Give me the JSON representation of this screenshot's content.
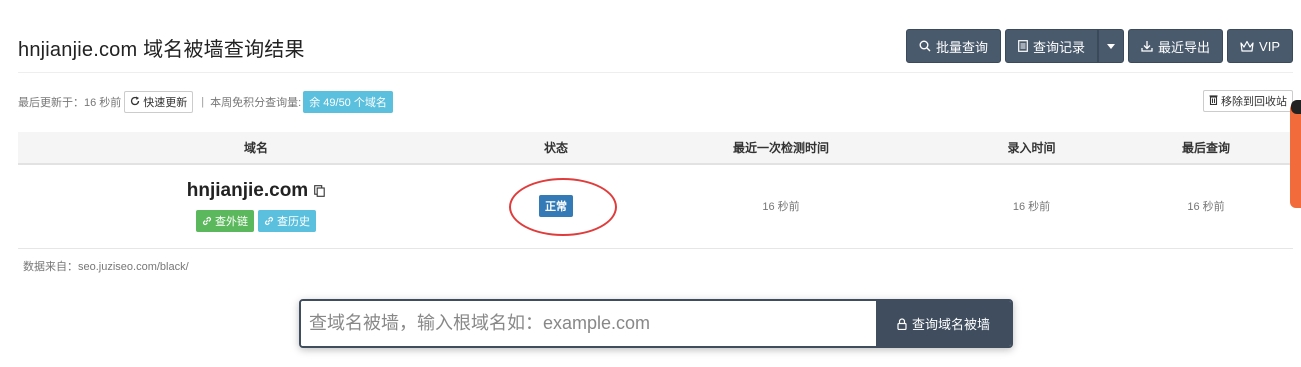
{
  "page": {
    "title": "hnjianjie.com 域名被墙查询结果"
  },
  "toolbar": {
    "batch_label": "批量查询",
    "history_label": "查询记录",
    "export_label": "最近导出",
    "vip_label": "VIP"
  },
  "meta": {
    "updated_text": "最后更新于：16 秒前",
    "refresh_label": "快速更新",
    "separator": "|",
    "quota_text": "本周免积分查询量:",
    "quota_badge": "余 49/50 个域名",
    "recycle_label": "移除到回收站"
  },
  "table": {
    "headers": [
      "域名",
      "状态",
      "最近一次检测时间",
      "录入时间",
      "最后查询"
    ],
    "rows": [
      {
        "domain": "hnjianjie.com",
        "links_label": "查外链",
        "history_label": "查历史",
        "status": "正常",
        "check_time": "16 秒前",
        "entry_time": "16 秒前",
        "last_query": "16 秒前"
      }
    ]
  },
  "source": {
    "text": "数据来自：seo.juziseo.com/black/"
  },
  "search": {
    "placeholder": "查域名被墙，输入根域名如：example.com",
    "button_label": "查询域名被墙"
  },
  "colors": {
    "dark_button": "#4a5a6d",
    "badge_info": "#5bc0de",
    "badge_success": "#5cb85c",
    "badge_primary": "#337ab7",
    "annotation": "#e03c3c",
    "side_tab": "#f26b3a"
  },
  "icons": {
    "batch": "search-icon",
    "history": "document-icon",
    "export": "download-icon",
    "vip": "crown-icon",
    "refresh": "refresh-icon",
    "recycle": "trash-icon",
    "copy": "copy-icon",
    "link": "link-icon",
    "lock": "lock-icon"
  }
}
